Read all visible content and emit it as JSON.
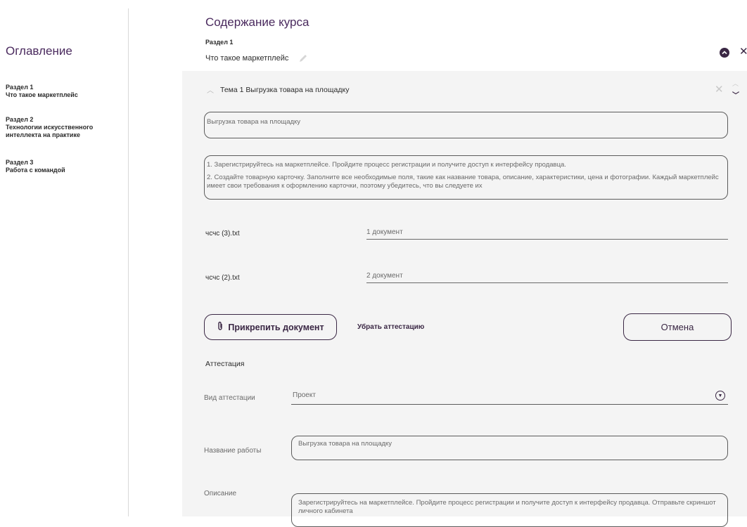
{
  "sidebar": {
    "title": "Оглавление",
    "items": [
      {
        "section": "Раздел 1",
        "name": "Что такое маркетплейс"
      },
      {
        "section": "Раздел 2",
        "name": "Технологии искусственного интеллекта на практике"
      },
      {
        "section": "Раздел 3",
        "name": "Работа с командой"
      }
    ]
  },
  "main": {
    "title": "Содержание курса",
    "section_label": "Раздел 1",
    "section_name": "Что такое маркетплейс",
    "topic": {
      "title": "Тема 1  Выгрузка товара на площадку",
      "name_value": "Выгрузка товара на площадку",
      "text_p1": "1. Зарегистрируйтесь на маркетплейсе. Пройдите процесс регистрации и получите доступ к интерфейсу продавца.",
      "text_p2": "2. Создайте товарную карточку. Заполните все необходимые поля, такие как название товара, описание, характеристики, цена и фотографии. Каждый маркетплейс имеет свои требования к оформлению карточки, поэтому убедитесь, что вы следуете их"
    },
    "documents": [
      {
        "file": "чсчс (3).txt",
        "title": "1 документ"
      },
      {
        "file": "чсчс (2).txt",
        "title": "2 документ"
      }
    ],
    "attach_label": "Прикрепить документ",
    "remove_attestation_label": "Убрать аттестацию",
    "cancel_label": "Отмена",
    "attestation": {
      "heading": "Аттестация",
      "type_label": "Вид аттестации",
      "type_value": "Проект",
      "work_name_label": "Название работы",
      "work_name_value": "Выгрузка товара на площадку",
      "description_label": "Описание",
      "description_value": "Зарегистрируйтесь на маркетплейсе. Пройдите процесс регистрации и получите доступ к интерфейсу продавца. Отправьте скриншот личного кабинета"
    }
  },
  "colors": {
    "accent": "#3a2744",
    "heading": "#4a2a5e",
    "panel": "#f4f4f4"
  },
  "icons": [
    "pencil-icon",
    "chevron-up-icon",
    "close-icon",
    "chevron-down-icon",
    "paperclip-icon",
    "dropdown-arrow-icon"
  ]
}
